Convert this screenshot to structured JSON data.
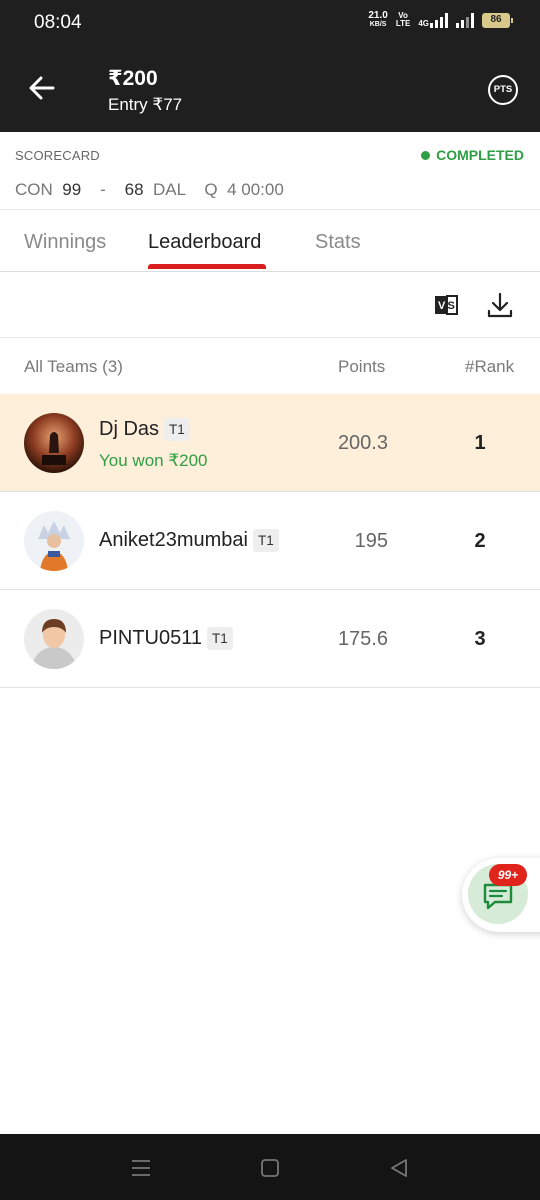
{
  "status_bar": {
    "time": "08:04",
    "net_speed": "21.0",
    "net_speed_unit": "KB/S",
    "volte_top": "Vo",
    "volte_bottom": "LTE",
    "network_type": "4G",
    "battery": "86"
  },
  "header": {
    "prize": "₹200",
    "entry": "Entry ₹77",
    "pts_label": "PTS",
    "back_icon": "arrow-left-icon"
  },
  "scorecard": {
    "label": "SCORECARD",
    "status": "COMPLETED",
    "status_color": "#2f9e44",
    "team1": "CON",
    "team1_score": "99",
    "separator": "-",
    "team2_score": "68",
    "team2": "DAL",
    "quarter": "Q",
    "clock": "4 00:00"
  },
  "tabs": [
    {
      "label": "Winnings",
      "active": false
    },
    {
      "label": "Leaderboard",
      "active": true
    },
    {
      "label": "Stats",
      "active": false
    }
  ],
  "toolbar": {
    "compare_icon": "vs-compare-icon",
    "download_icon": "download-icon"
  },
  "table": {
    "headers": {
      "teams": "All Teams (3)",
      "points": "Points",
      "rank": "#Rank"
    },
    "rows": [
      {
        "name": "Dj Das",
        "team": "T1",
        "subtext": "You won ₹200",
        "points": "200.3",
        "rank": "1",
        "highlight": true
      },
      {
        "name": "Aniket23mumbai",
        "team": "T1",
        "points": "195",
        "rank": "2",
        "highlight": false
      },
      {
        "name": "PINTU0511",
        "team": "T1",
        "points": "175.6",
        "rank": "3",
        "highlight": false
      }
    ]
  },
  "chat": {
    "badge": "99+",
    "icon": "chat-icon"
  },
  "nav": {
    "menu_icon": "menu-icon",
    "home_icon": "home-square-icon",
    "back_icon": "back-triangle-icon"
  },
  "colors": {
    "header_bg": "#1f1f1f",
    "accent": "#d81e1e",
    "highlight_row": "#fdefd9",
    "success": "#2f9e44"
  }
}
